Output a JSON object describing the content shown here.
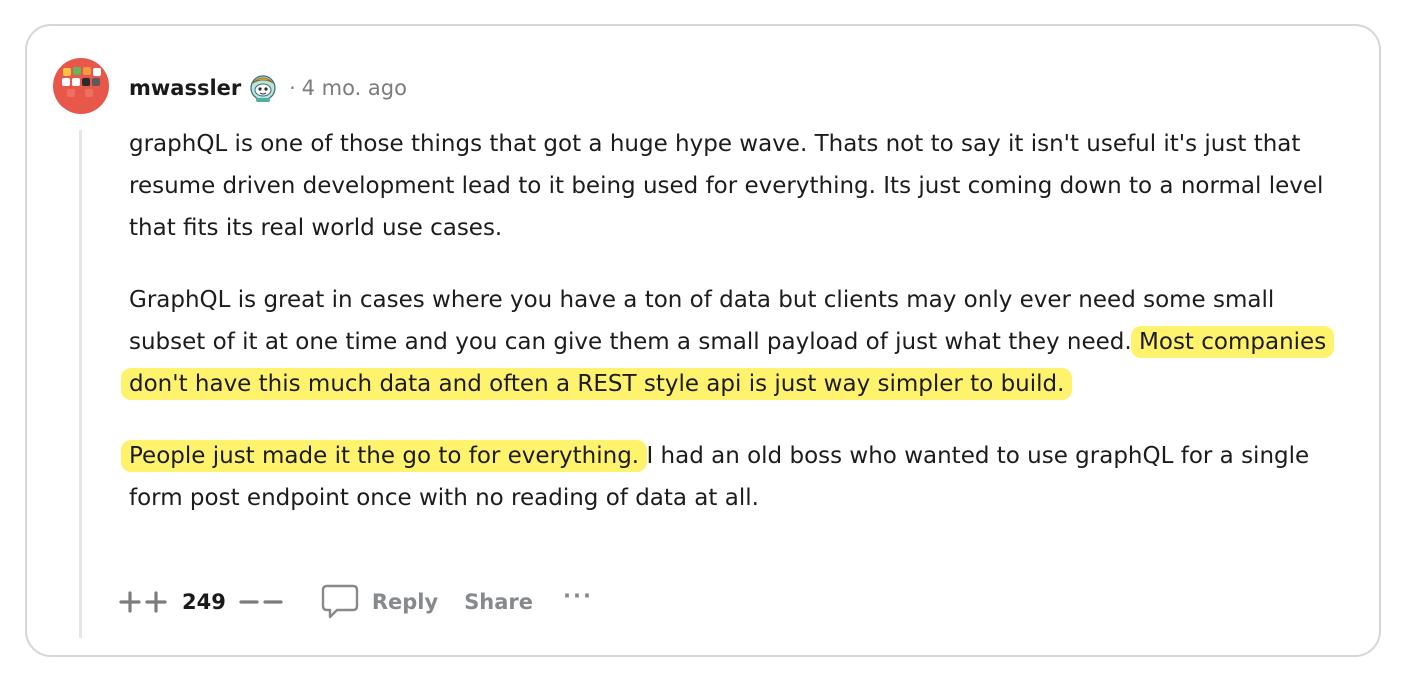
{
  "comment": {
    "author": "mwassler",
    "separator": "·",
    "timestamp": "4 mo. ago",
    "paragraphs": {
      "p1": "graphQL is one of those things that got a huge hype wave. Thats not to say it isn't useful it's just that resume driven development lead to it being used for everything. Its just coming down to a normal level that fits its real world use cases.",
      "p2_plain": "GraphQL is great in cases where you have a ton of data but clients may only ever need some small subset of it at one time and you can give them a small payload of just what they need.",
      "p2_highlight": "Most companies don't have this much data and often a REST style api is just way simpler to build.",
      "p3_highlight": "People just made it the go to for everything.",
      "p3_plain": "I had an old boss who wanted to use graphQL for a single form post endpoint once with no reading of data at all."
    },
    "highlight_color": "#fff36e"
  },
  "actions": {
    "score": "249",
    "reply_label": "Reply",
    "share_label": "Share",
    "more_label": "···"
  },
  "icons": {
    "upvote": "upvote-arrow-icon",
    "downvote": "downvote-arrow-icon",
    "reply": "comment-bubble-icon",
    "flair": "snoo-avatar-icon"
  }
}
